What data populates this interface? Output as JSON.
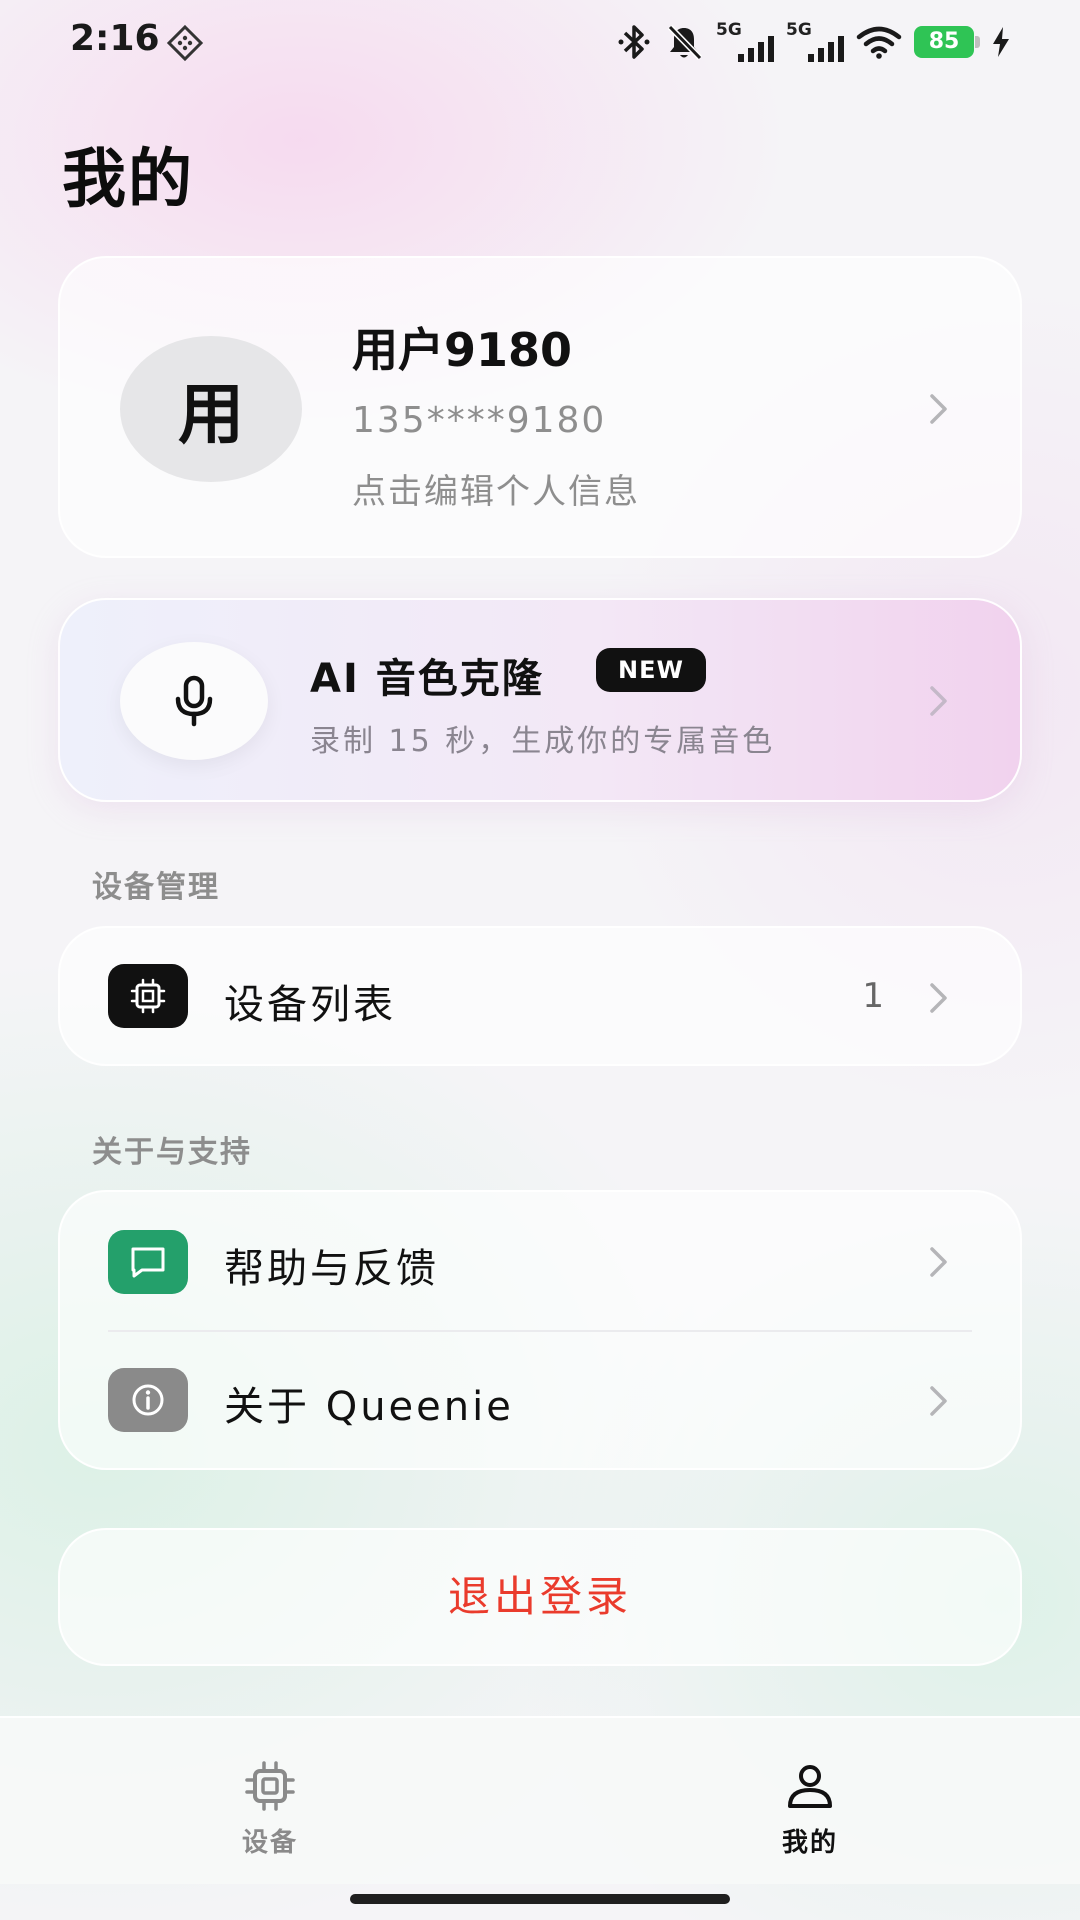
{
  "status_bar": {
    "time": "2:16",
    "network_1": "5G",
    "network_2": "5G",
    "battery_level": "85",
    "battery_color": "#2fc455",
    "icons": [
      "nfc-icon",
      "bluetooth-icon",
      "bell-off-icon",
      "signal-icon",
      "signal-icon",
      "wifi-icon",
      "battery-icon",
      "charging-icon"
    ]
  },
  "page": {
    "title": "我的"
  },
  "profile": {
    "avatar_text": "用",
    "name": "用户9180",
    "phone": "135****9180",
    "hint": "点击编辑个人信息"
  },
  "voice_clone": {
    "title": "AI 音色克隆",
    "badge": "NEW",
    "subtitle": "录制 15 秒，生成你的专属音色",
    "icon": "microphone-icon"
  },
  "sections": {
    "device": {
      "label": "设备管理",
      "items": [
        {
          "label": "设备列表",
          "count": "1",
          "icon": "chip-icon",
          "icon_bg": "#111111"
        }
      ]
    },
    "support": {
      "label": "关于与支持",
      "items": [
        {
          "label": "帮助与反馈",
          "icon": "message-icon",
          "icon_bg": "#24a06b"
        },
        {
          "label": "关于 Queenie",
          "icon": "info-icon",
          "icon_bg": "#8a8a8a"
        }
      ]
    }
  },
  "logout": {
    "label": "退出登录",
    "color": "#ea3b2c"
  },
  "bottom_nav": {
    "items": [
      {
        "label": "设备",
        "icon": "chip-icon",
        "active": false
      },
      {
        "label": "我的",
        "icon": "user-icon",
        "active": true
      }
    ]
  }
}
